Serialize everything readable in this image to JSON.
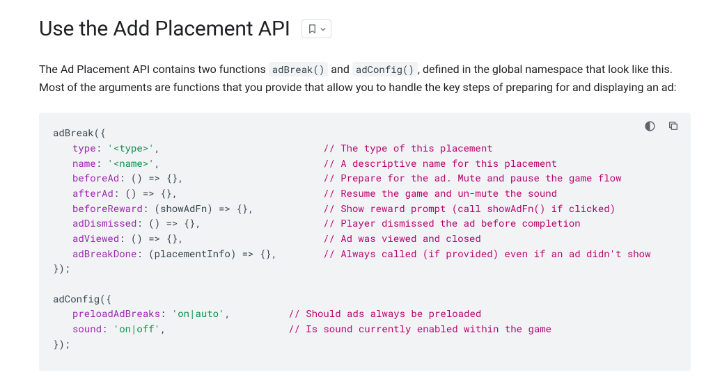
{
  "title": "Use the Add Placement API",
  "intro": {
    "pre": "The Ad Placement API contains two functions ",
    "code1": "adBreak()",
    "mid1": " and ",
    "code2": "adConfig()",
    "post": ", defined in the global namespace that look like this. Most of the arguments are functions that you provide that allow you to handle the key steps of preparing for and displaying an ad:"
  },
  "code": {
    "adBreak_open": "adBreak({",
    "rows1": [
      {
        "k": "type",
        "v": "'<type>'",
        "sep": ",",
        "c": "// The type of this placement"
      },
      {
        "k": "name",
        "v": "'<name>'",
        "sep": ",",
        "c": "// A descriptive name for this placement"
      },
      {
        "k": "beforeAd",
        "v": "() => {}",
        "sep": ",",
        "c": "// Prepare for the ad. Mute and pause the game flow"
      },
      {
        "k": "afterAd",
        "v": "() => {}",
        "sep": ",",
        "c": "// Resume the game and un-mute the sound"
      },
      {
        "k": "beforeReward",
        "v": "(showAdFn) => {}",
        "sep": ",",
        "c": "// Show reward prompt (call showAdFn() if clicked)"
      },
      {
        "k": "adDismissed",
        "v": "() => {}",
        "sep": ",",
        "c": "// Player dismissed the ad before completion"
      },
      {
        "k": "adViewed",
        "v": "() => {}",
        "sep": ",",
        "c": "// Ad was viewed and closed"
      },
      {
        "k": "adBreakDone",
        "v": "(placementInfo) => {}",
        "sep": ",",
        "c": "// Always called (if provided) even if an ad didn't show"
      }
    ],
    "adBreak_close": "});",
    "adConfig_open": "adConfig({",
    "rows2": [
      {
        "k": "preloadAdBreaks",
        "v": "'on|auto'",
        "sep": ",",
        "c": "// Should ads always be preloaded"
      },
      {
        "k": "sound",
        "v": "'on|off'",
        "sep": ",",
        "c": "// Is sound currently enabled within the game"
      }
    ],
    "adConfig_close": "});"
  }
}
